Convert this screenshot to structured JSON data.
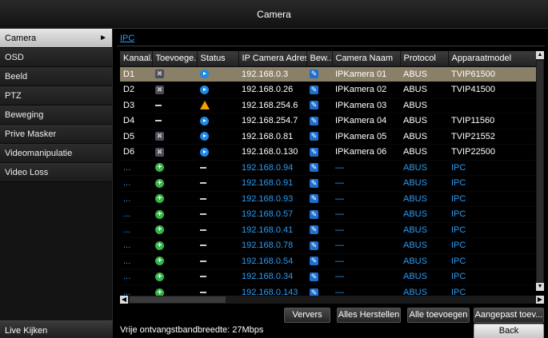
{
  "window": {
    "title": "Camera"
  },
  "sidebar": {
    "items": [
      {
        "label": "Camera",
        "active": true
      },
      {
        "label": "OSD"
      },
      {
        "label": "Beeld"
      },
      {
        "label": "PTZ"
      },
      {
        "label": "Beweging"
      },
      {
        "label": "Prive Masker"
      },
      {
        "label": "Videomanipulatie"
      },
      {
        "label": "Video Loss"
      }
    ],
    "live_label": "Live Kijken"
  },
  "tabs": {
    "ipc": "IPC"
  },
  "table": {
    "headers": [
      "Kanaal...",
      "Toevoege...",
      "Status",
      "IP Camera Adres",
      "Bew...",
      "Camera Naam",
      "Protocol",
      "Apparaatmodel"
    ],
    "rows": [
      {
        "kanaal": "D1",
        "add": "delete-icon",
        "status": "play-icon",
        "ip": "192.168.0.3",
        "edit": "edit-icon",
        "name": "IPKamera 01",
        "protocol": "ABUS",
        "model": "TVIP61500",
        "selected": true
      },
      {
        "kanaal": "D2",
        "add": "delete-icon",
        "status": "play-icon",
        "ip": "192.168.0.26",
        "edit": "edit-icon",
        "name": "IPKamera 02",
        "protocol": "ABUS",
        "model": "TVIP41500"
      },
      {
        "kanaal": "D3",
        "add": "dash-icon",
        "status": "warning-icon",
        "ip": "192.168.254.6",
        "edit": "edit-icon",
        "name": "IPKamera 03",
        "protocol": "ABUS",
        "model": ""
      },
      {
        "kanaal": "D4",
        "add": "dash-icon",
        "status": "play-icon",
        "ip": "192.168.254.7",
        "edit": "edit-icon",
        "name": "IPKamera 04",
        "protocol": "ABUS",
        "model": "TVIP11560"
      },
      {
        "kanaal": "D5",
        "add": "delete-icon",
        "status": "play-icon",
        "ip": "192.168.0.81",
        "edit": "edit-icon",
        "name": "IPKamera 05",
        "protocol": "ABUS",
        "model": "TVIP21552"
      },
      {
        "kanaal": "D6",
        "add": "delete-icon",
        "status": "play-icon",
        "ip": "192.168.0.130",
        "edit": "edit-icon",
        "name": "IPKamera 06",
        "protocol": "ABUS",
        "model": "TVIP22500"
      },
      {
        "kanaal": "...",
        "add": "add-icon",
        "status": "dash-icon",
        "ip": "192.168.0.94",
        "edit": "edit-icon",
        "name": "—",
        "protocol": "ABUS",
        "model": "IPC",
        "blue": true
      },
      {
        "kanaal": "...",
        "add": "add-icon",
        "status": "dash-icon",
        "ip": "192.168.0.91",
        "edit": "edit-icon",
        "name": "—",
        "protocol": "ABUS",
        "model": "IPC",
        "blue": true
      },
      {
        "kanaal": "...",
        "add": "add-icon",
        "status": "dash-icon",
        "ip": "192.168.0.93",
        "edit": "edit-icon",
        "name": "—",
        "protocol": "ABUS",
        "model": "IPC",
        "blue": true
      },
      {
        "kanaal": "...",
        "add": "add-icon",
        "status": "dash-icon",
        "ip": "192.168.0.57",
        "edit": "edit-icon",
        "name": "—",
        "protocol": "ABUS",
        "model": "IPC",
        "blue": true
      },
      {
        "kanaal": "...",
        "add": "add-icon",
        "status": "dash-icon",
        "ip": "192.168.0.41",
        "edit": "edit-icon",
        "name": "—",
        "protocol": "ABUS",
        "model": "IPC",
        "blue": true
      },
      {
        "kanaal": "...",
        "add": "add-icon",
        "status": "dash-icon",
        "ip": "192.168.0.78",
        "edit": "edit-icon",
        "name": "—",
        "protocol": "ABUS",
        "model": "IPC",
        "blue": true
      },
      {
        "kanaal": "...",
        "add": "add-icon",
        "status": "dash-icon",
        "ip": "192.168.0.54",
        "edit": "edit-icon",
        "name": "—",
        "protocol": "ABUS",
        "model": "IPC",
        "blue": true
      },
      {
        "kanaal": "...",
        "add": "add-icon",
        "status": "dash-icon",
        "ip": "192.168.0.34",
        "edit": "edit-icon",
        "name": "—",
        "protocol": "ABUS",
        "model": "IPC",
        "blue": true
      },
      {
        "kanaal": "...",
        "add": "add-icon",
        "status": "dash-icon",
        "ip": "192.168.0.143",
        "edit": "edit-icon",
        "name": "—",
        "protocol": "ABUS",
        "model": "IPC",
        "blue": true
      }
    ]
  },
  "buttons": {
    "refresh": "Ververs",
    "reset_all": "Alles Herstellen",
    "add_all": "Alle toevoegen",
    "custom_add": "Aangepast toev...",
    "back": "Back"
  },
  "footer": {
    "bandwidth": "Vrije ontvangstbandbreedte: 27Mbps"
  },
  "colors": {
    "accent": "#2b9cf5",
    "selected_row": "#8a8068",
    "status_ok": "#1e88e5",
    "warning": "#f2a100",
    "add": "#35b34a"
  }
}
